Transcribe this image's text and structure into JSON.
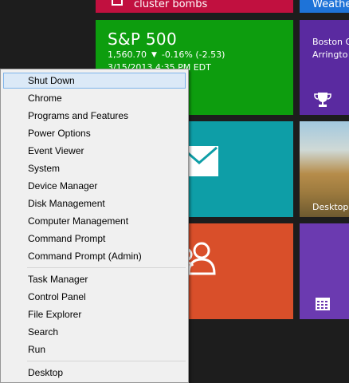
{
  "tiles": {
    "news": {
      "label": "cluster bombs"
    },
    "weather": {
      "label": "Weather"
    },
    "finance": {
      "title": "S&P 500",
      "value": "1,560.70",
      "change": "-0.16% (-2.53)",
      "timestamp": "3/15/2013 4:35 PM EDT",
      "color": "#0d9d0e"
    },
    "sports": {
      "line1": "Boston G",
      "line2": "Arringto"
    },
    "mail": {
      "icon": "mail-icon",
      "color": "#0e9ea7"
    },
    "photos": {
      "label": "Desktop"
    },
    "people": {
      "icon": "people-icon",
      "color": "#d94f2a"
    },
    "calendar": {
      "icon": "calendar-icon"
    }
  },
  "menu": {
    "items": [
      {
        "label": "Shut Down",
        "selected": true
      },
      {
        "label": "Chrome"
      },
      {
        "label": "Programs and Features"
      },
      {
        "label": "Power Options"
      },
      {
        "label": "Event Viewer"
      },
      {
        "label": "System"
      },
      {
        "label": "Device Manager"
      },
      {
        "label": "Disk Management"
      },
      {
        "label": "Computer Management"
      },
      {
        "label": "Command Prompt"
      },
      {
        "label": "Command Prompt (Admin)"
      },
      {
        "label": "Task Manager"
      },
      {
        "label": "Control Panel"
      },
      {
        "label": "File Explorer"
      },
      {
        "label": "Search"
      },
      {
        "label": "Run"
      },
      {
        "label": "Desktop"
      }
    ]
  }
}
